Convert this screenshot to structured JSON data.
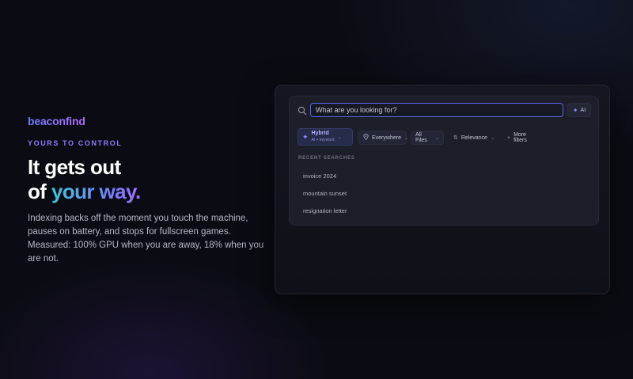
{
  "brand": {
    "name": "beaconfind"
  },
  "hero": {
    "eyebrow": "YOURS TO CONTROL",
    "headline_line1": "It gets out",
    "headline_line2_prefix": "of ",
    "headline_line2_highlight": "your way.",
    "body": "Indexing backs off the moment you touch the machine, pauses on battery, and stops for fullscreen games. Measured: 100% GPU when you are away, 18% when you are not."
  },
  "search": {
    "placeholder": "What are you looking for?",
    "value": "",
    "ai_button_label": "AI"
  },
  "filters": {
    "mode": {
      "label": "Hybrid",
      "sublabel": "AI + keyword"
    },
    "location": "Everywhere",
    "type": "All Files",
    "sort": "Relevance",
    "more": "More filters"
  },
  "recent": {
    "label": "RECENT SEARCHES",
    "items": [
      "invoice 2024",
      "mountain sunset",
      "resignation letter"
    ]
  },
  "colors": {
    "accent": "#5a66f0",
    "eyebrow": "#8b7dff",
    "background": "#0b0c13"
  }
}
